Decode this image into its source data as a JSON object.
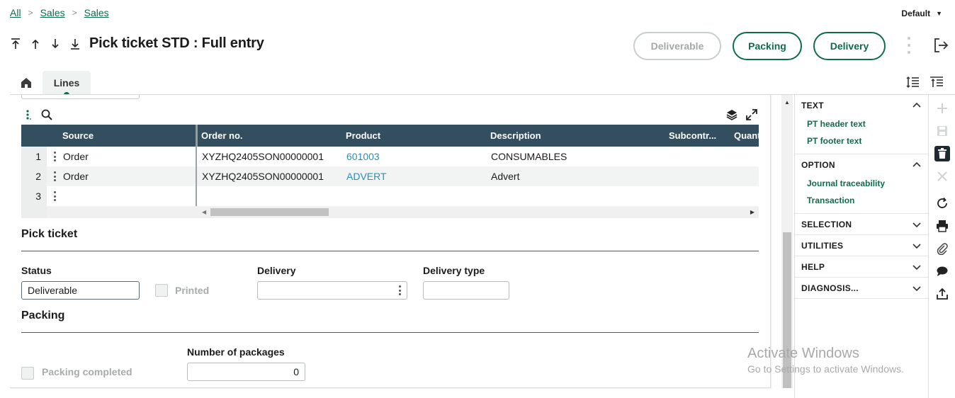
{
  "breadcrumb": {
    "items": [
      "All",
      "Sales",
      "Sales"
    ]
  },
  "profile_selector": {
    "label": "Default"
  },
  "header": {
    "title": "Pick ticket STD : Full entry",
    "buttons": {
      "deliverable": "Deliverable",
      "packing": "Packing",
      "delivery": "Delivery"
    }
  },
  "tabs": {
    "lines": "Lines"
  },
  "grid": {
    "columns": [
      "Source",
      "Order no.",
      "Product",
      "Description",
      "Subcontr...",
      "Quant"
    ],
    "rows": [
      {
        "num": "1",
        "source": "Order",
        "order_no": "XYZHQ2405SON00000001",
        "product": "601003",
        "description": "CONSUMABLES"
      },
      {
        "num": "2",
        "source": "Order",
        "order_no": "XYZHQ2405SON00000001",
        "product": "ADVERT",
        "description": "Advert"
      },
      {
        "num": "3",
        "source": "",
        "order_no": "",
        "product": "",
        "description": ""
      }
    ]
  },
  "pick_ticket": {
    "section_title": "Pick ticket",
    "status_label": "Status",
    "status_value": "Deliverable",
    "printed_label": "Printed",
    "delivery_label": "Delivery",
    "delivery_value": "",
    "delivery_type_label": "Delivery type",
    "delivery_type_value": ""
  },
  "packing": {
    "section_title": "Packing",
    "packing_completed_label": "Packing completed",
    "num_packages_label": "Number of packages",
    "num_packages_value": "0"
  },
  "side_panel": {
    "sections": [
      {
        "title": "TEXT",
        "expanded": true,
        "items": [
          "PT header text",
          "PT footer text"
        ]
      },
      {
        "title": "OPTION",
        "expanded": true,
        "items": [
          "Journal traceability",
          "Transaction"
        ]
      },
      {
        "title": "SELECTION",
        "expanded": false,
        "items": []
      },
      {
        "title": "UTILITIES",
        "expanded": false,
        "items": []
      },
      {
        "title": "HELP",
        "expanded": false,
        "items": []
      },
      {
        "title": "DIAGNOSIS...",
        "expanded": false,
        "items": []
      }
    ]
  },
  "watermark": {
    "line1": "Activate Windows",
    "line2": "Go to Settings to activate Windows."
  },
  "colors": {
    "brand_green": "#0f6b4e",
    "grid_header": "#334f5f",
    "link_blue": "#2b8fb4"
  }
}
